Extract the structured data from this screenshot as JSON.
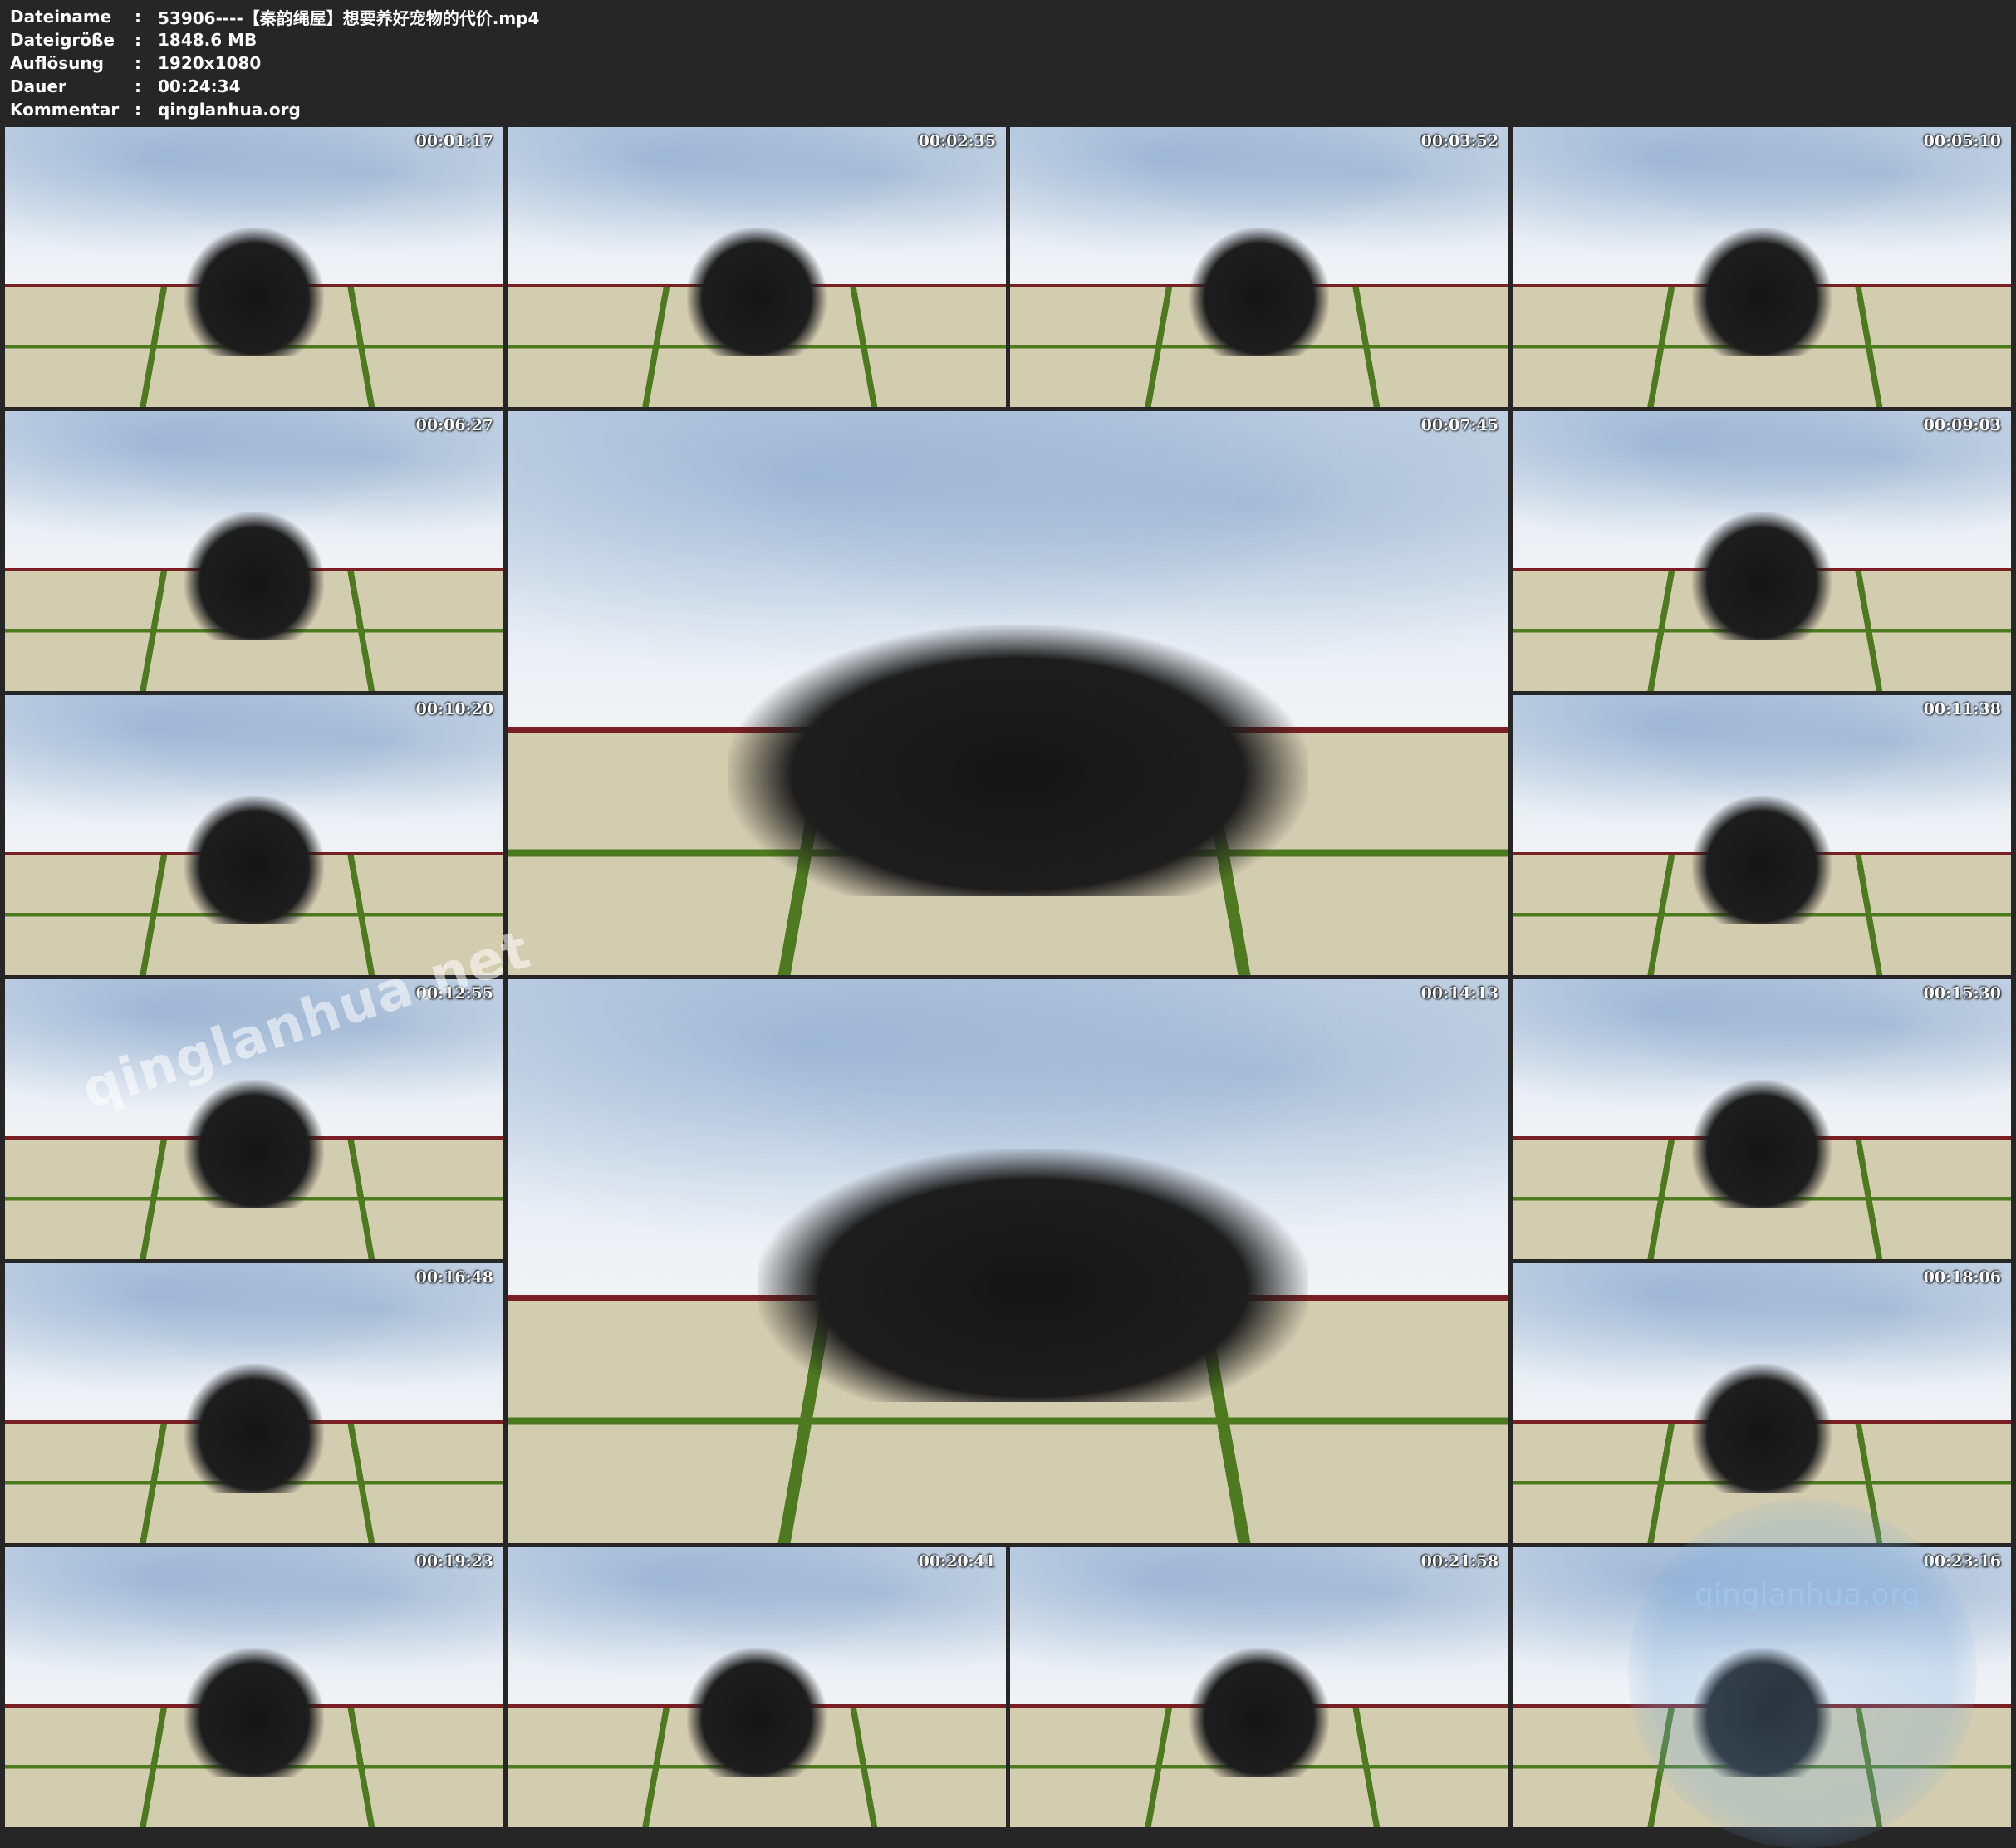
{
  "header": {
    "rows": [
      {
        "label": "Dateiname",
        "sep": ":",
        "value": "53906----【秦韵绳屋】想要养好宠物的代价.mp4"
      },
      {
        "label": "Dateigröße",
        "sep": ":",
        "value": "1848.6 MB"
      },
      {
        "label": "Auflösung",
        "sep": ":",
        "value": "1920x1080"
      },
      {
        "label": "Dauer",
        "sep": ":",
        "value": "00:24:34"
      },
      {
        "label": "Kommentar",
        "sep": ":",
        "value": "qinglanhua.org"
      }
    ]
  },
  "thumbnails": [
    {
      "time": "00:01:17"
    },
    {
      "time": "00:02:35"
    },
    {
      "time": "00:03:52"
    },
    {
      "time": "00:05:10"
    },
    {
      "time": "00:06:27"
    },
    {
      "time": "00:07:45"
    },
    {
      "time": "00:09:03"
    },
    {
      "time": "00:10:20"
    },
    {
      "time": "00:11:38"
    },
    {
      "time": "00:12:55"
    },
    {
      "time": "00:14:13"
    },
    {
      "time": "00:15:30"
    },
    {
      "time": "00:16:48"
    },
    {
      "time": "00:18:06"
    },
    {
      "time": "00:19:23"
    },
    {
      "time": "00:20:41"
    },
    {
      "time": "00:21:58"
    },
    {
      "time": "00:23:16"
    }
  ],
  "watermarks": {
    "diagonal": "qinglanhua.net",
    "corner": "qinglanhua.org"
  }
}
